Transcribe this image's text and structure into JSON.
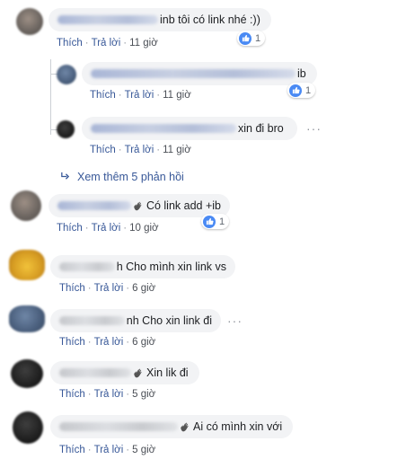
{
  "actions": {
    "like": "Thích",
    "reply": "Trả lời",
    "separator": "·"
  },
  "comments": [
    {
      "text": "inb tôi có link nhé :))",
      "time": "11 giờ",
      "reactions": "1"
    },
    {
      "text": "ib",
      "time": "11 giờ",
      "reactions": "1"
    },
    {
      "text": "xin đi bro",
      "time": "11 giờ"
    },
    {
      "text": "Có link add +ib",
      "time": "10 giờ",
      "reactions": "1"
    },
    {
      "text": "h Cho mình xin link vs",
      "time": "6 giờ"
    },
    {
      "text": "nh Cho xin link đi",
      "time": "6 giờ"
    },
    {
      "text": "Xin lik đi",
      "time": "5 giờ"
    },
    {
      "text": "Ai có mình xin với",
      "time": "5 giờ"
    }
  ],
  "more_replies": "Xem thêm 5 phản hồi",
  "more_options": "···",
  "icons": {
    "like": "like-thumb-icon",
    "reply_arrow": "reply-arrow-icon",
    "wave": "waving-hand-icon"
  },
  "colors": {
    "link": "#385898",
    "bubble": "#f2f3f5",
    "like_blue": "#4a8af4"
  }
}
